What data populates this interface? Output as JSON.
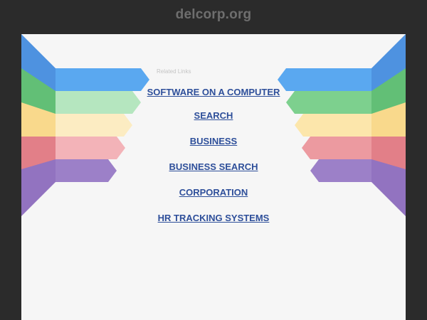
{
  "page": {
    "domain": "delcorp.org",
    "related_label": "Related Links"
  },
  "links": [
    {
      "label": "SOFTWARE ON A COMPUTER"
    },
    {
      "label": "SEARCH"
    },
    {
      "label": "BUSINESS"
    },
    {
      "label": "BUSINESS SEARCH"
    },
    {
      "label": "CORPORATION"
    },
    {
      "label": "HR TRACKING SYSTEMS"
    }
  ],
  "colors": {
    "background": "#2b2b2b",
    "panel": "#f6f6f6",
    "link": "#2e4f9a",
    "ribbon_blue": "#5aa8f0",
    "ribbon_green": "#7dd08e",
    "ribbon_yellow": "#fbe3a4",
    "ribbon_red": "#ec9aa0",
    "ribbon_purple": "#9c80c8"
  }
}
